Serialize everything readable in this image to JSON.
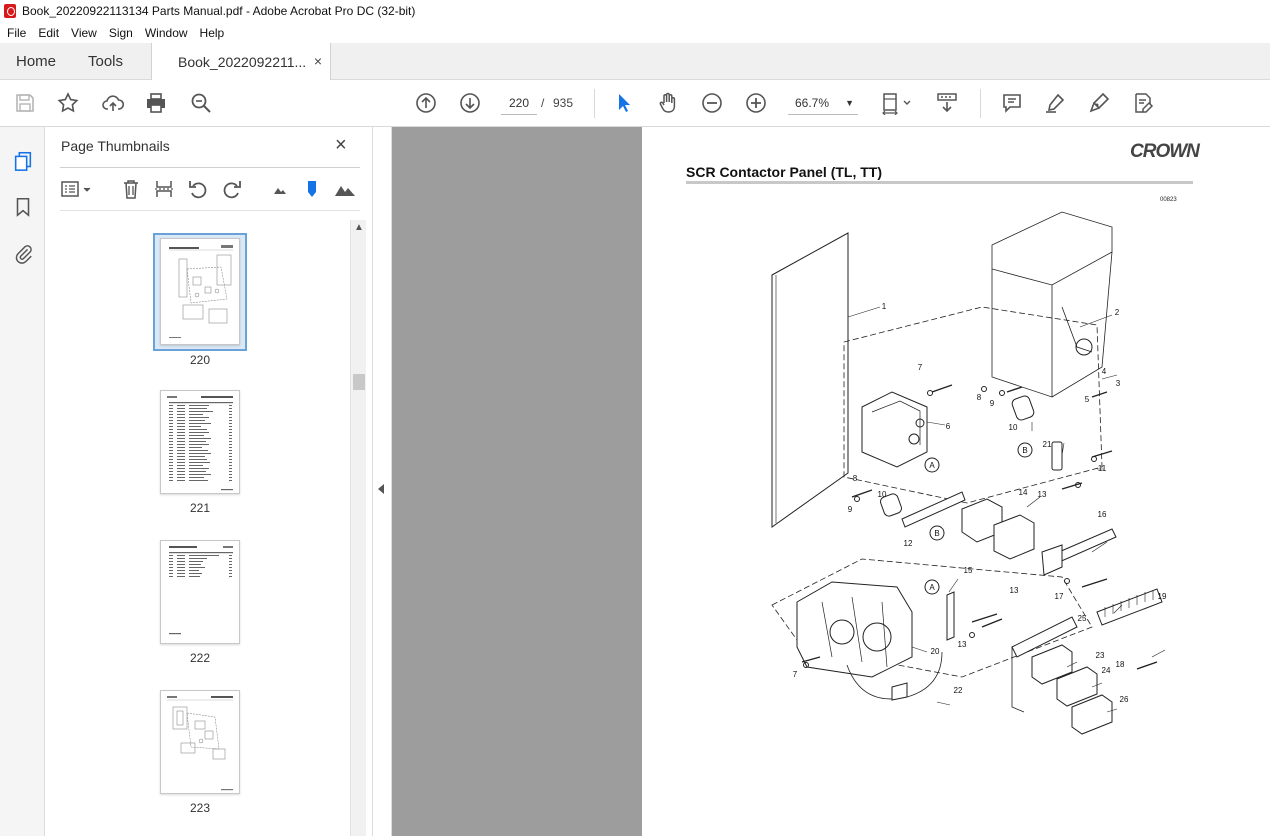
{
  "window": {
    "title": "Book_20220922113134 Parts Manual.pdf - Adobe Acrobat Pro DC (32-bit)"
  },
  "menu": [
    "File",
    "Edit",
    "View",
    "Sign",
    "Window",
    "Help"
  ],
  "tabs": {
    "home": "Home",
    "tools": "Tools",
    "document": "Book_2022092211...",
    "close": "×"
  },
  "toolbar": {
    "current_page": "220",
    "separator": "/",
    "total_pages": "935",
    "zoom": "66.7%",
    "zoom_caret": "▼"
  },
  "thumbnails_panel": {
    "title": "Page Thumbnails",
    "close": "×",
    "pages": [
      {
        "number": "220",
        "selected": true
      },
      {
        "number": "221",
        "selected": false
      },
      {
        "number": "222",
        "selected": false
      },
      {
        "number": "223",
        "selected": false
      }
    ]
  },
  "document_page": {
    "logo": "CROWN",
    "heading": "SCR Contactor Panel (TL, TT)",
    "figure_number": "00823",
    "callouts": [
      "1",
      "2",
      "3",
      "4",
      "5",
      "6",
      "7",
      "8",
      "9",
      "10",
      "11",
      "12",
      "13",
      "14",
      "15",
      "16",
      "17",
      "18",
      "19",
      "20",
      "21",
      "22",
      "23",
      "24",
      "25",
      "26",
      "A",
      "B"
    ]
  },
  "colors": {
    "accent_blue": "#1473e6",
    "selection_blue": "#6aa2d8",
    "viewer_bg": "#9d9d9d",
    "acrobat_red": "#d7191c"
  }
}
